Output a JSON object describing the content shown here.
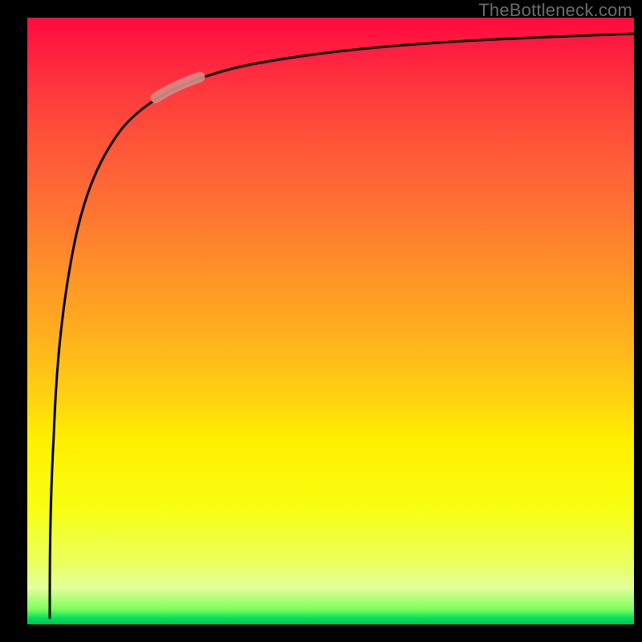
{
  "attribution": "TheBottleneck.com",
  "chart_data": {
    "type": "line",
    "title": "",
    "xlabel": "",
    "ylabel": "",
    "xlim": [
      0,
      100
    ],
    "ylim": [
      0,
      100
    ],
    "background_gradient": {
      "orientation": "vertical",
      "stops": [
        {
          "pos": 0,
          "color": "#ff0a3e"
        },
        {
          "pos": 40,
          "color": "#ff8a2c"
        },
        {
          "pos": 70,
          "color": "#fff000"
        },
        {
          "pos": 92,
          "color": "#e6ff80"
        },
        {
          "pos": 100,
          "color": "#00c050"
        }
      ]
    },
    "series": [
      {
        "name": "bottleneck-curve",
        "color": "#000000",
        "x": [
          4,
          4.3,
          4.9,
          5.6,
          6.4,
          7.3,
          8.5,
          10,
          12,
          15,
          19,
          24,
          30,
          38,
          48,
          60,
          75,
          90,
          100
        ],
        "y": [
          2,
          17,
          34,
          48,
          58,
          66,
          72,
          78,
          82.5,
          86,
          89,
          91,
          92.5,
          93.8,
          94.8,
          95.6,
          96.3,
          96.9,
          97.2
        ]
      }
    ],
    "highlight": {
      "name": "highlight-segment",
      "color": "#d38b87",
      "x_range": [
        22,
        28
      ],
      "y_range": [
        89.5,
        91.5
      ]
    }
  }
}
